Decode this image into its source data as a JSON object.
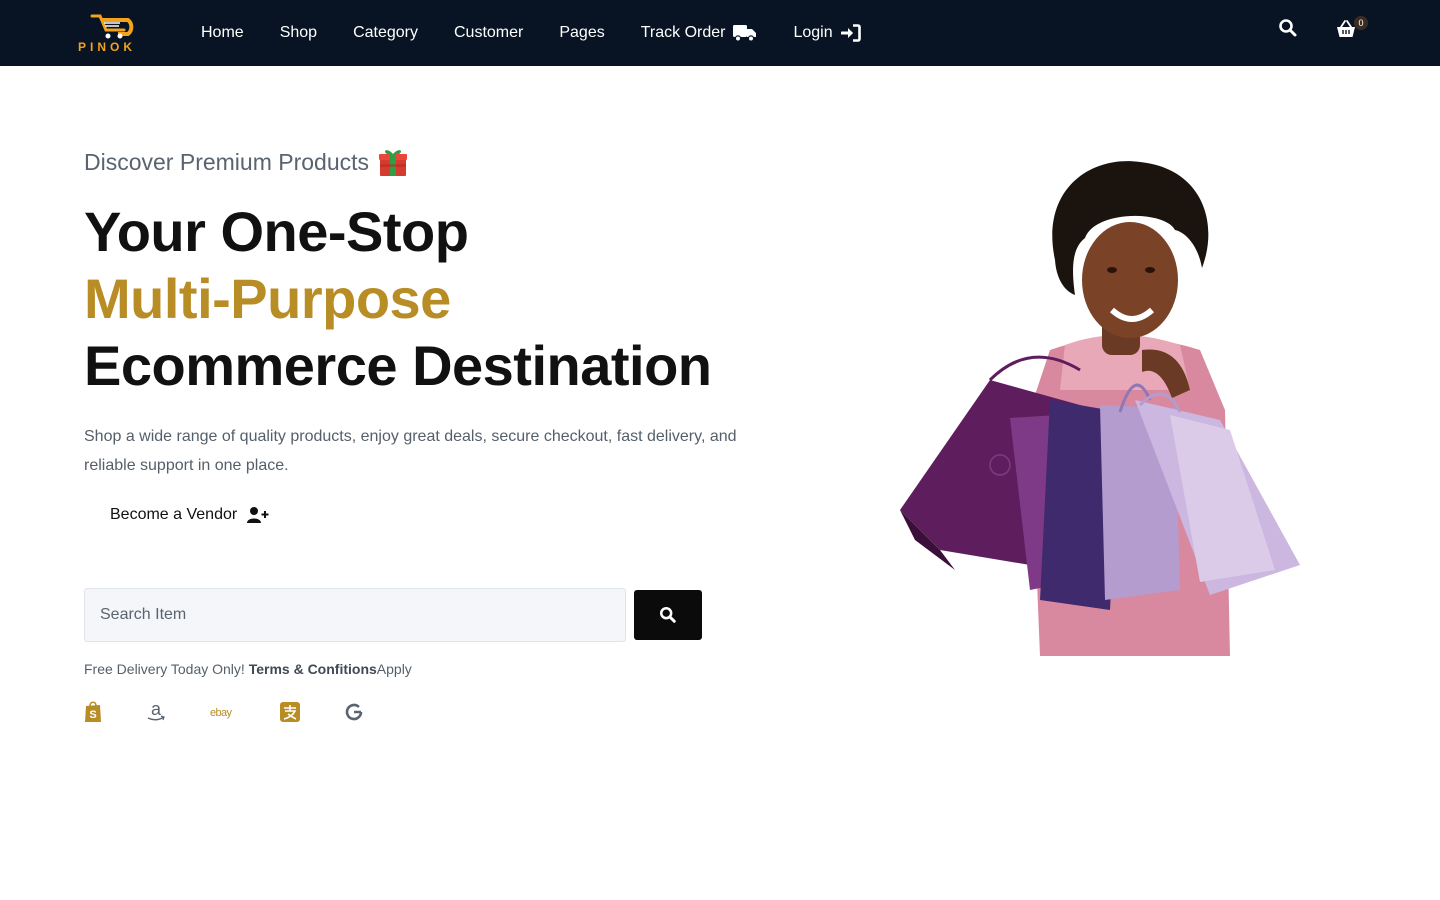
{
  "header": {
    "logo_text": "PINOK",
    "nav": [
      {
        "label": "Home"
      },
      {
        "label": "Shop"
      },
      {
        "label": "Category"
      },
      {
        "label": "Customer"
      },
      {
        "label": "Pages"
      },
      {
        "label": "Track Order",
        "icon": "truck-icon"
      },
      {
        "label": "Login",
        "icon": "login-icon"
      }
    ],
    "cart_count": "0"
  },
  "hero": {
    "kicker": "Discover Premium Products",
    "headline_line1": "Your One-Stop",
    "headline_line2": "Multi-Purpose",
    "headline_line3": "Ecommerce Destination",
    "description": "Shop a wide range of quality products, enjoy great deals, secure checkout, fast delivery, and reliable support in one place.",
    "vendor_button": "Become a Vendor",
    "search_placeholder": "Search Item",
    "delivery_prefix": "Free Delivery Today Only! ",
    "delivery_terms": "Terms & Confitions",
    "delivery_suffix": "Apply",
    "brands": [
      "shopify-icon",
      "amazon-icon",
      "ebay-icon",
      "alipay-icon",
      "google-icon"
    ],
    "ebay_text": "ebay"
  },
  "colors": {
    "header_bg": "#081423",
    "accent": "#b88d25",
    "logo_orange": "#f2a21c"
  }
}
